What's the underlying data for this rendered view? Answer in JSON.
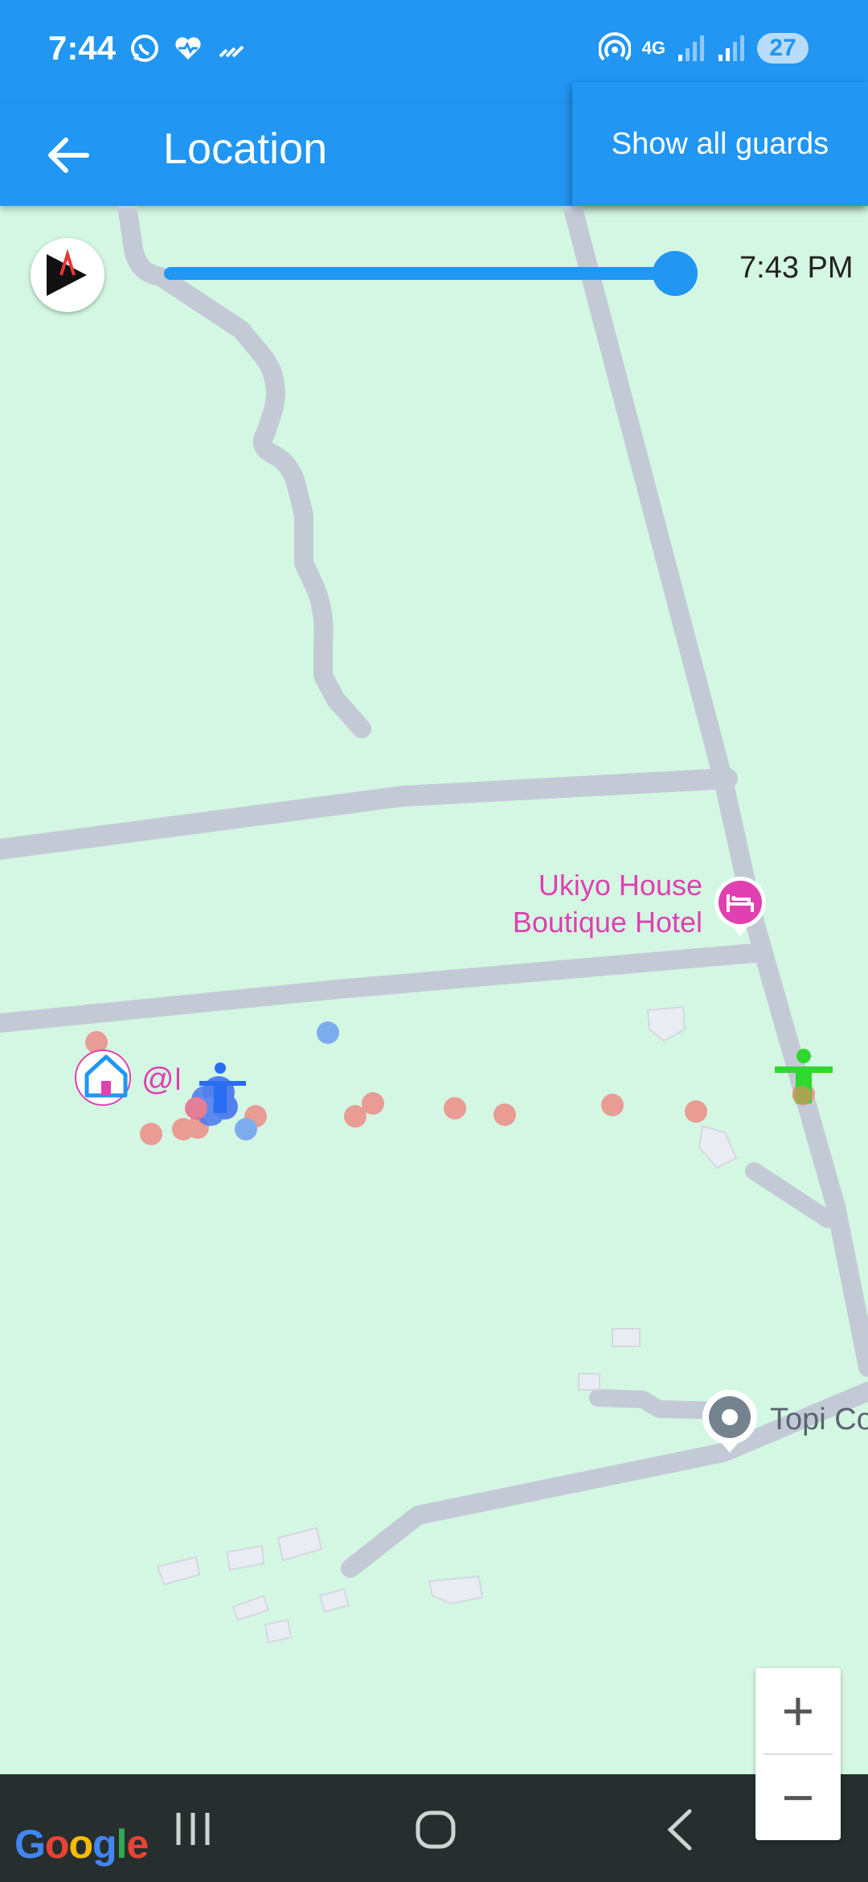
{
  "status_bar": {
    "time": "7:44",
    "network": "4G",
    "battery": "27"
  },
  "app_bar": {
    "title": "Location",
    "menu_item": "Show all guards"
  },
  "timeline": {
    "time_label": "7:43 PM",
    "position_fraction": 1.0
  },
  "map": {
    "places": [
      {
        "name_line1": "Ukiyo House",
        "name_line2": "Boutique Hotel",
        "type": "hotel"
      },
      {
        "name": "Topi Co",
        "type": "place"
      }
    ],
    "home_label": "@Mei",
    "colors": {
      "background": "#d4f7e3",
      "road": "#c3cad6",
      "trail_red": "#ec8d87",
      "trail_blue": "#6f9ff0",
      "guard_active": "#2ed82e",
      "poi_pink": "#e040b0"
    }
  },
  "zoom": {
    "in_label": "+",
    "out_label": "−"
  },
  "attribution": "Google"
}
